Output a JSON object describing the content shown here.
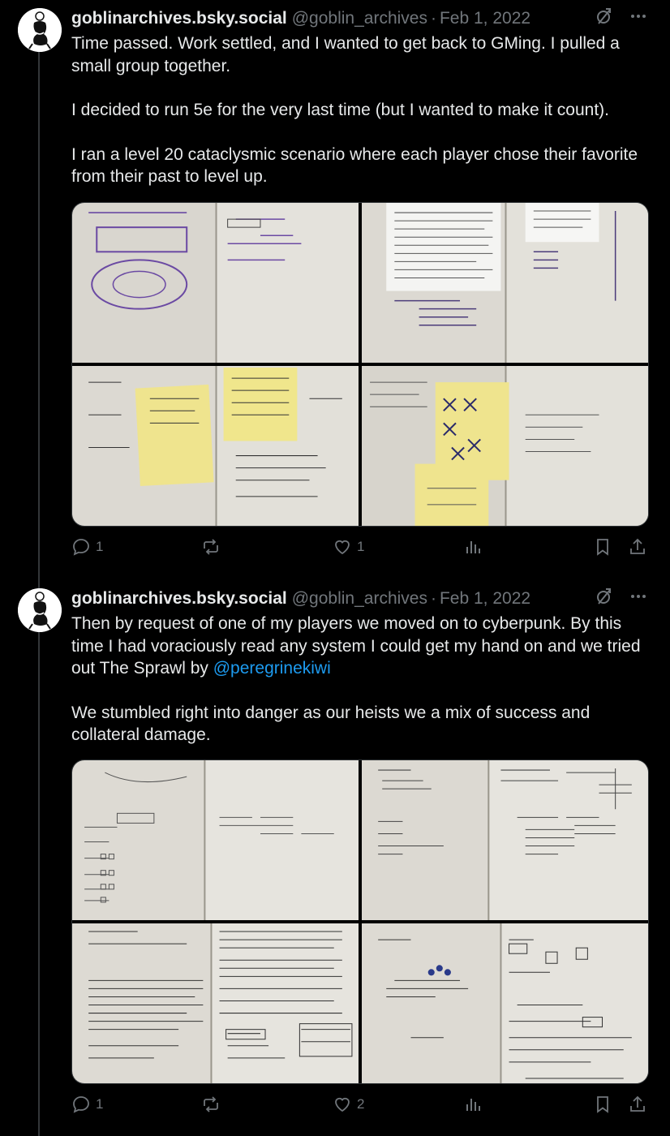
{
  "posts": [
    {
      "display_name": "goblinarchives.bsky.social",
      "handle": "@goblin_archives",
      "separator": "·",
      "date": "Feb 1, 2022",
      "paragraphs": [
        "Time passed. Work settled, and I wanted to get back to GMing. I pulled a small group together.",
        "I decided to run 5e for the very last time (but I wanted to make it count).",
        "I ran a level 20 cataclysmic scenario where each player chose their favorite from their past to level up."
      ],
      "media": [
        {
          "icon": "notebook-photo-icon",
          "subject": "hand-drawn map sketch"
        },
        {
          "icon": "notebook-photo-icon",
          "subject": "printed rules sheet with notes"
        },
        {
          "icon": "notebook-photo-icon",
          "subject": "yellow sticky notes on notebook"
        },
        {
          "icon": "notebook-photo-icon",
          "subject": "sticky note with crossed-out marks"
        }
      ],
      "replies": "1",
      "reposts": "",
      "likes": "1"
    },
    {
      "display_name": "goblinarchives.bsky.social",
      "handle": "@goblin_archives",
      "separator": "·",
      "date": "Feb 1, 2022",
      "paragraph1_text": "Then by request of one of my players we moved on to cyberpunk. By this time I had voraciously read any system I could get my hand on and we tried out The Sprawl by ",
      "mention": "@peregrinekiwi",
      "paragraph2": "We stumbled right into danger as our heists we a mix of success and collateral damage.",
      "media": [
        {
          "icon": "notebook-photo-icon",
          "subject": "notebook with checkbox lists"
        },
        {
          "icon": "notebook-photo-icon",
          "subject": "notebook with character names"
        },
        {
          "icon": "notebook-photo-icon",
          "subject": "dense handwritten notes"
        },
        {
          "icon": "notebook-photo-icon",
          "subject": "notebook with diagram sketches"
        }
      ],
      "replies": "1",
      "reposts": "",
      "likes": "2"
    }
  ],
  "icons": {
    "crosspost": "crosspost-icon",
    "more": "more-icon",
    "reply": "reply-icon",
    "repost": "repost-icon",
    "like": "like-icon",
    "views": "views-icon",
    "bookmark": "bookmark-icon",
    "share": "share-icon"
  },
  "colors": {
    "background": "#000000",
    "text": "#e7e9ea",
    "secondary": "#71767b",
    "link": "#1d9bf0",
    "thread_line": "#333639"
  }
}
